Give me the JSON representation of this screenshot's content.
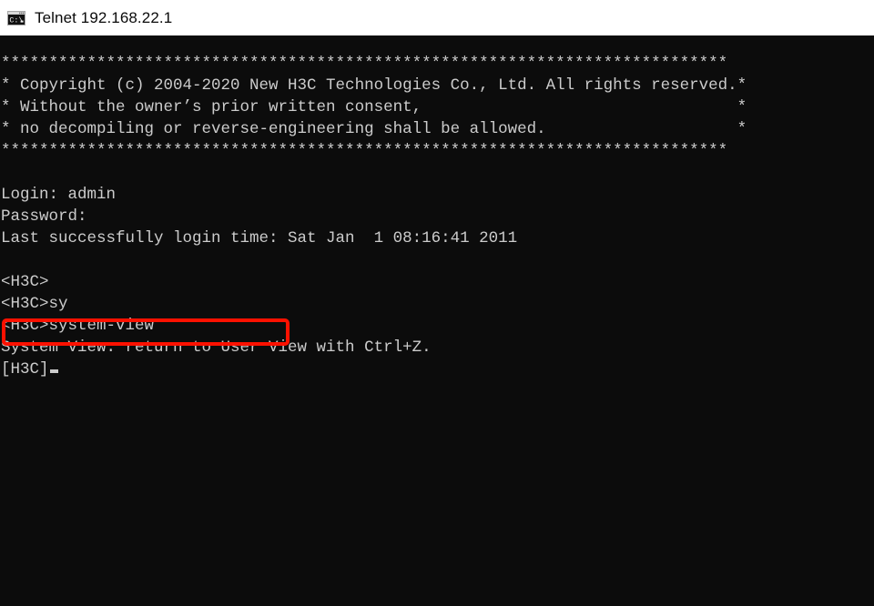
{
  "window": {
    "title": "Telnet 192.168.22.1",
    "icon": "console-window-icon"
  },
  "theme": {
    "titlebar_background": "#ffffff",
    "titlebar_text": "#0a0a0a",
    "terminal_background": "#0c0c0c",
    "terminal_text": "#cccccc",
    "annotation_color": "#fd1100"
  },
  "terminal": {
    "lines": [
      "****************************************************************************",
      "* Copyright (c) 2004-2020 New H3C Technologies Co., Ltd. All rights reserved.*",
      "* Without the owner’s prior written consent,                                 *",
      "* no decompiling or reverse-engineering shall be allowed.                    *",
      "****************************************************************************",
      "",
      "Login: admin",
      "Password:",
      "Last successfully login time: Sat Jan  1 08:16:41 2011",
      "",
      "<H3C>",
      "<H3C>sy",
      "<H3C>system-view",
      "System View: return to User View with Ctrl+Z.",
      "[H3C]"
    ],
    "prompt_user_view": "<H3C>",
    "prompt_system_view": "[H3C]",
    "typed_command": "system-view",
    "cursor": "block-cursor"
  },
  "annotation": {
    "label": "highlight-rectangle",
    "targets_line": "<H3C>system-view"
  }
}
